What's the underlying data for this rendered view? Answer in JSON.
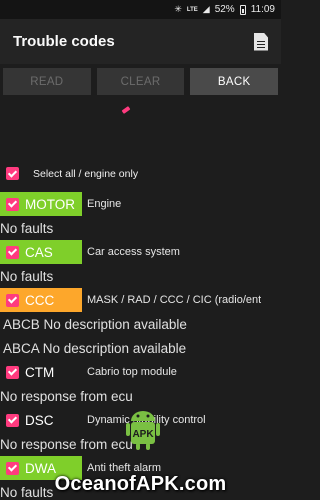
{
  "status_bar": {
    "bluetooth_icon": "bluetooth-icon",
    "network_label": "LTE",
    "battery": "52%",
    "time": "11:09"
  },
  "app_bar": {
    "title": "Trouble codes",
    "action_icon": "document-icon"
  },
  "buttons": {
    "read": "READ",
    "clear": "CLEAR",
    "back": "BACK"
  },
  "select_all": {
    "label": "Select all / engine only",
    "checked": true
  },
  "accent_color": "#ff3b7f",
  "rows": [
    {
      "type": "module",
      "name": "MOTOR",
      "description": "Engine",
      "color": "#7fcf2a",
      "checked": true
    },
    {
      "type": "result",
      "text": "No faults"
    },
    {
      "type": "module",
      "name": "CAS",
      "description": "Car access system",
      "color": "#7fcf2a",
      "checked": true
    },
    {
      "type": "result",
      "text": "No faults"
    },
    {
      "type": "module",
      "name": "CCC",
      "description": "MASK / RAD / CCC / CIC (radio/ent",
      "color": "#fda72b",
      "checked": true
    },
    {
      "type": "result",
      "text": " ABCB No description available"
    },
    {
      "type": "result",
      "text": " ABCA No description available"
    },
    {
      "type": "module",
      "name": "CTM",
      "description": "Cabrio top module",
      "color": "",
      "checked": true
    },
    {
      "type": "result",
      "text": "No response from ecu"
    },
    {
      "type": "module",
      "name": "DSC",
      "description": "Dynamic stability control",
      "color": "",
      "checked": true
    },
    {
      "type": "result",
      "text": "No response from ecu"
    },
    {
      "type": "module",
      "name": "DWA",
      "description": "Anti theft alarm",
      "color": "#7fcf2a",
      "checked": true
    },
    {
      "type": "result",
      "text": "No faults"
    }
  ],
  "watermark": {
    "text": "OceanofAPK.com",
    "logo_text": "APK"
  }
}
